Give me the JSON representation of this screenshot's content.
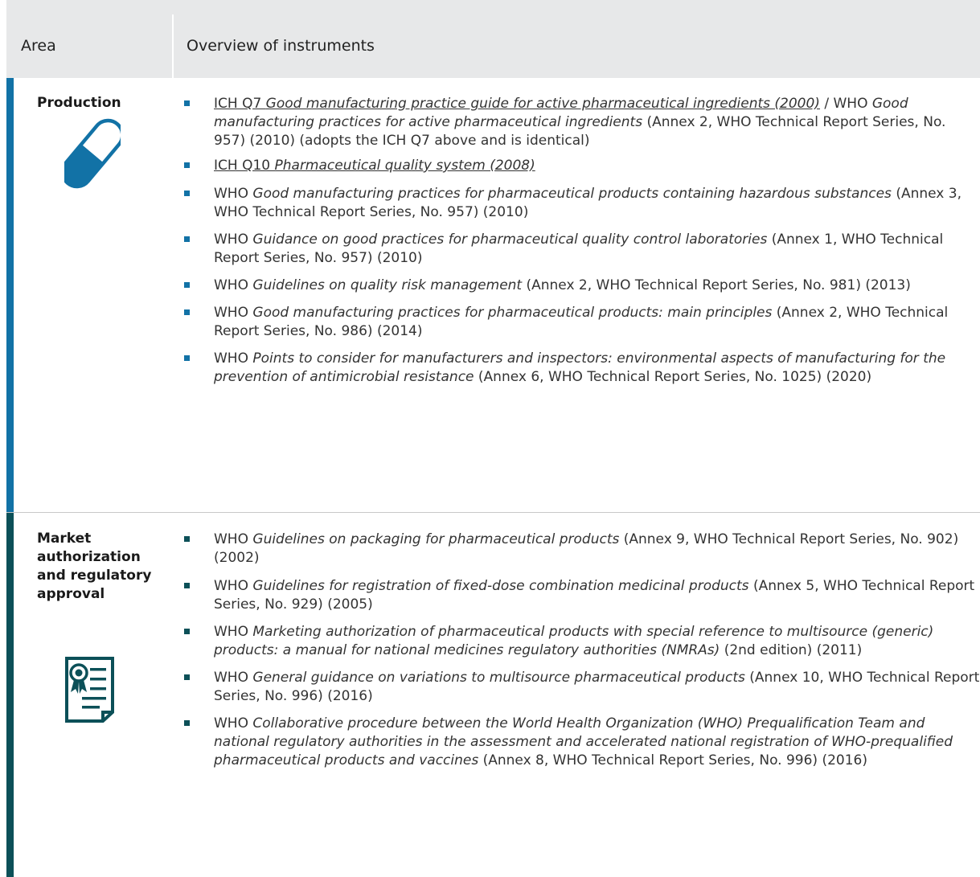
{
  "header": {
    "area": "Area",
    "overview": "Overview of instruments"
  },
  "sections": [
    {
      "title": "Production",
      "icon": "pill-icon",
      "color": "#1272a6",
      "items": [
        [
          "ICH Q7 ",
          "Good manufacturing practice guide for active pharmaceutical ingredients (2000)",
          " / WHO ",
          "Good manufacturing practices for active pharmaceutical ingredients",
          " (Annex 2, WHO Technical Report Series, No. 957) (2010) (adopts the ICH Q7 above and is identical)"
        ],
        [
          "ICH Q10 ",
          "Pharmaceutical quality system (2008)"
        ],
        [
          "WHO ",
          "Good manufacturing practices for pharmaceutical products containing hazardous substances",
          " (Annex 3, WHO Technical Report Series, No. 957) (2010)"
        ],
        [
          "WHO ",
          "Guidance on good practices for pharmaceutical quality control laboratories",
          " (Annex 1, WHO Technical Report Series, No. 957) (2010)"
        ],
        [
          "WHO ",
          "Guidelines on quality risk management",
          " (Annex 2, WHO Technical Report Series, No. 981) (2013)"
        ],
        [
          "WHO ",
          "Good manufacturing practices for pharmaceutical products: main principles",
          " (Annex 2, WHO Technical Report Series, No. 986) (2014)"
        ],
        [
          "WHO ",
          "Points to consider for manufacturers and inspectors: environmental aspects of manufacturing for the prevention of antimicrobial resistance",
          " (Annex 6, WHO Technical Report Series, No. 1025) (2020)"
        ]
      ]
    },
    {
      "title": "Market authorization and regulatory approval",
      "icon": "certificate-icon",
      "color": "#0c5058",
      "items": [
        [
          "WHO ",
          "Guidelines on packaging for pharmaceutical products",
          " (Annex 9, WHO Technical Report Series, No. 902) (2002)"
        ],
        [
          "WHO ",
          "Guidelines for registration of fixed-dose combination medicinal products",
          " (Annex 5, WHO Technical Report Series, No. 929) (2005)"
        ],
        [
          "WHO ",
          "Marketing authorization of pharmaceutical products with special reference to multisource (generic) products: a manual for national medicines regulatory authorities (NMRAs)",
          " (2nd edition) (2011)"
        ],
        [
          "WHO ",
          "General guidance on variations to multisource pharmaceutical products",
          " (Annex 10, WHO Technical Report Series, No. 996) (2016)"
        ],
        [
          "WHO ",
          "Collaborative procedure between the World Health Organization (WHO) Prequalification Team and national regulatory authorities in the assessment and accelerated national registration of WHO-prequalified pharmaceutical products and vaccines",
          " (Annex 8, WHO Technical Report Series, No. 996) (2016)"
        ]
      ]
    }
  ]
}
